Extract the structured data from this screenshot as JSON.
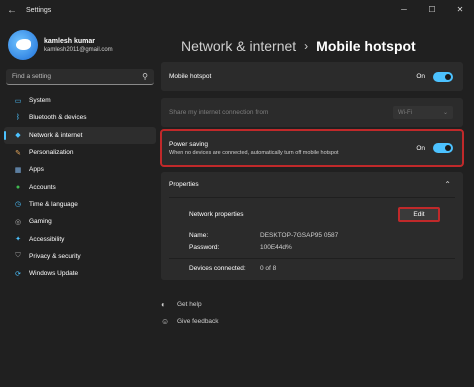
{
  "window": {
    "title": "Settings",
    "controls": [
      "─",
      "☐",
      "✕"
    ]
  },
  "user": {
    "name": "kamlesh kumar",
    "email": "kamlesh2011@gmail.com"
  },
  "search": {
    "placeholder": "Find a setting"
  },
  "nav": {
    "items": [
      {
        "label": "System",
        "icon": "monitor-icon",
        "color": "#4cc2ff"
      },
      {
        "label": "Bluetooth & devices",
        "icon": "bluetooth-icon",
        "color": "#4cc2ff"
      },
      {
        "label": "Network & internet",
        "icon": "network-icon",
        "color": "#4cc2ff",
        "active": true
      },
      {
        "label": "Personalization",
        "icon": "brush-icon",
        "color": "#e8a95c"
      },
      {
        "label": "Apps",
        "icon": "apps-icon",
        "color": "#7fb3e8"
      },
      {
        "label": "Accounts",
        "icon": "person-icon",
        "color": "#3fb950"
      },
      {
        "label": "Time & language",
        "icon": "clock-icon",
        "color": "#4cc2ff"
      },
      {
        "label": "Gaming",
        "icon": "gamepad-icon",
        "color": "#b0b0b0"
      },
      {
        "label": "Accessibility",
        "icon": "accessibility-icon",
        "color": "#4cc2ff"
      },
      {
        "label": "Privacy & security",
        "icon": "shield-icon",
        "color": "#9a9a9a"
      },
      {
        "label": "Windows Update",
        "icon": "update-icon",
        "color": "#4cc2ff"
      }
    ]
  },
  "header": {
    "parent": "Network & internet",
    "separator": "›",
    "current": "Mobile hotspot"
  },
  "hotspot": {
    "label": "Mobile hotspot",
    "state": "On"
  },
  "share": {
    "label": "Share my internet connection from",
    "value": "Wi-Fi"
  },
  "power_saving": {
    "label": "Power saving",
    "description": "When no devices are connected, automatically turn off mobile hotspot",
    "state": "On"
  },
  "properties": {
    "title": "Properties",
    "network_properties_label": "Network properties",
    "edit_label": "Edit",
    "name_label": "Name:",
    "name_value": "DESKTOP-7GSAP95 0587",
    "password_label": "Password:",
    "password_value": "100E44d%",
    "devices_label": "Devices connected:",
    "devices_value": "0 of 8"
  },
  "help": {
    "get_help": "Get help",
    "give_feedback": "Give feedback"
  },
  "colors": {
    "accent": "#4cc2ff",
    "highlight": "#c0292a"
  }
}
